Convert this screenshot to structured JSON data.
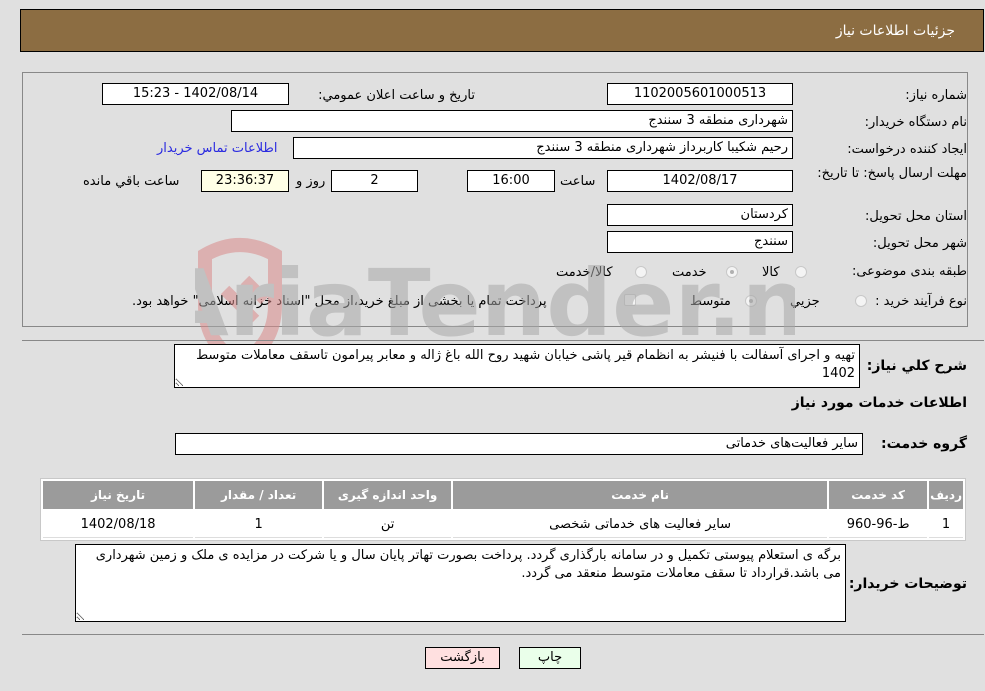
{
  "header": {
    "title": "جزئیات اطلاعات نیاز"
  },
  "need": {
    "number_label": "شماره نیاز:",
    "number_value": "1102005601000513",
    "announce_label": "تاریخ و ساعت اعلان عمومي:",
    "announce_value": "1402/08/14 - 15:23",
    "buyer_org_label": "نام دستگاه خریدار:",
    "buyer_org_value": "شهرداری منطقه 3 سنندج",
    "creator_label": "ایجاد کننده درخواست:",
    "creator_value": "رحیم شکیبا کاربرداز شهرداری منطقه 3 سنندج",
    "contact_link": "اطلاعات تماس خریدار",
    "deadline_label": "مهلت ارسال پاسخ: تا تاریخ:",
    "deadline_date": "1402/08/17",
    "time_label": "ساعت",
    "deadline_time": "16:00",
    "days_value": "2",
    "days_label": "روز و",
    "remaining_value": "23:36:37",
    "remaining_label": "ساعت باقي مانده",
    "province_label": "استان محل تحویل:",
    "province_value": "کردستان",
    "city_label": "شهر محل تحویل:",
    "city_value": "سنندج",
    "category_label": "طبقه بندی موضوعی:",
    "category_options": [
      {
        "label": "کالا",
        "selected": false
      },
      {
        "label": "خدمت",
        "selected": true
      },
      {
        "label": "کالا/خدمت",
        "selected": false
      }
    ],
    "process_label": "نوع فرآیند خرید :",
    "process_options": [
      {
        "label": "جزيي",
        "selected": false
      },
      {
        "label": "متوسط",
        "selected": true
      }
    ],
    "treasury_checkbox_label": "پرداخت تمام یا بخشی از مبلغ خرید،از محل \"اسناد خزانه اسلامی\" خواهد بود.",
    "treasury_checked": false
  },
  "description": {
    "label": "شرح كلي نیاز:",
    "value": "تهیه و اجرای آسفالت با فنیشر به انظمام قیر پاشی خیابان شهید روح الله باغ ژاله و معابر پیرامون تاسقف معاملات متوسط 1402"
  },
  "services": {
    "section_title": "اطلاعات خدمات مورد نیاز",
    "group_label": "گروه خدمت:",
    "group_value": "سایر فعالیت‌های خدماتی",
    "table": {
      "headers": [
        "ردیف",
        "کد خدمت",
        "نام خدمت",
        "واحد اندازه گیری",
        "تعداد / مقدار",
        "تاریخ نیاز"
      ],
      "rows": [
        [
          "1",
          "ط-96-960",
          "سایر فعالیت های خدماتی شخصی",
          "تن",
          "1",
          "1402/08/18"
        ]
      ]
    }
  },
  "buyer_notes": {
    "label": "توضیحات خریدار:",
    "value": "برگه ی استعلام پیوستی تکمیل و در سامانه بارگذاری گردد. پرداخت بصورت تهاتر پایان سال و یا شرکت در مزایده ی ملک و زمین شهرداری می باشد.قرارداد تا سقف معاملات متوسط منعقد می گردد."
  },
  "buttons": {
    "print": "چاپ",
    "back": "بازگشت"
  },
  "colors": {
    "header_bg": "#8c6d42",
    "print_bg": "#eaffea",
    "back_bg": "#ffe0e0",
    "remaining_bg": "#ffffe6",
    "link": "#2a2ae0"
  },
  "watermark": {
    "text": "AriaTender.neT"
  }
}
